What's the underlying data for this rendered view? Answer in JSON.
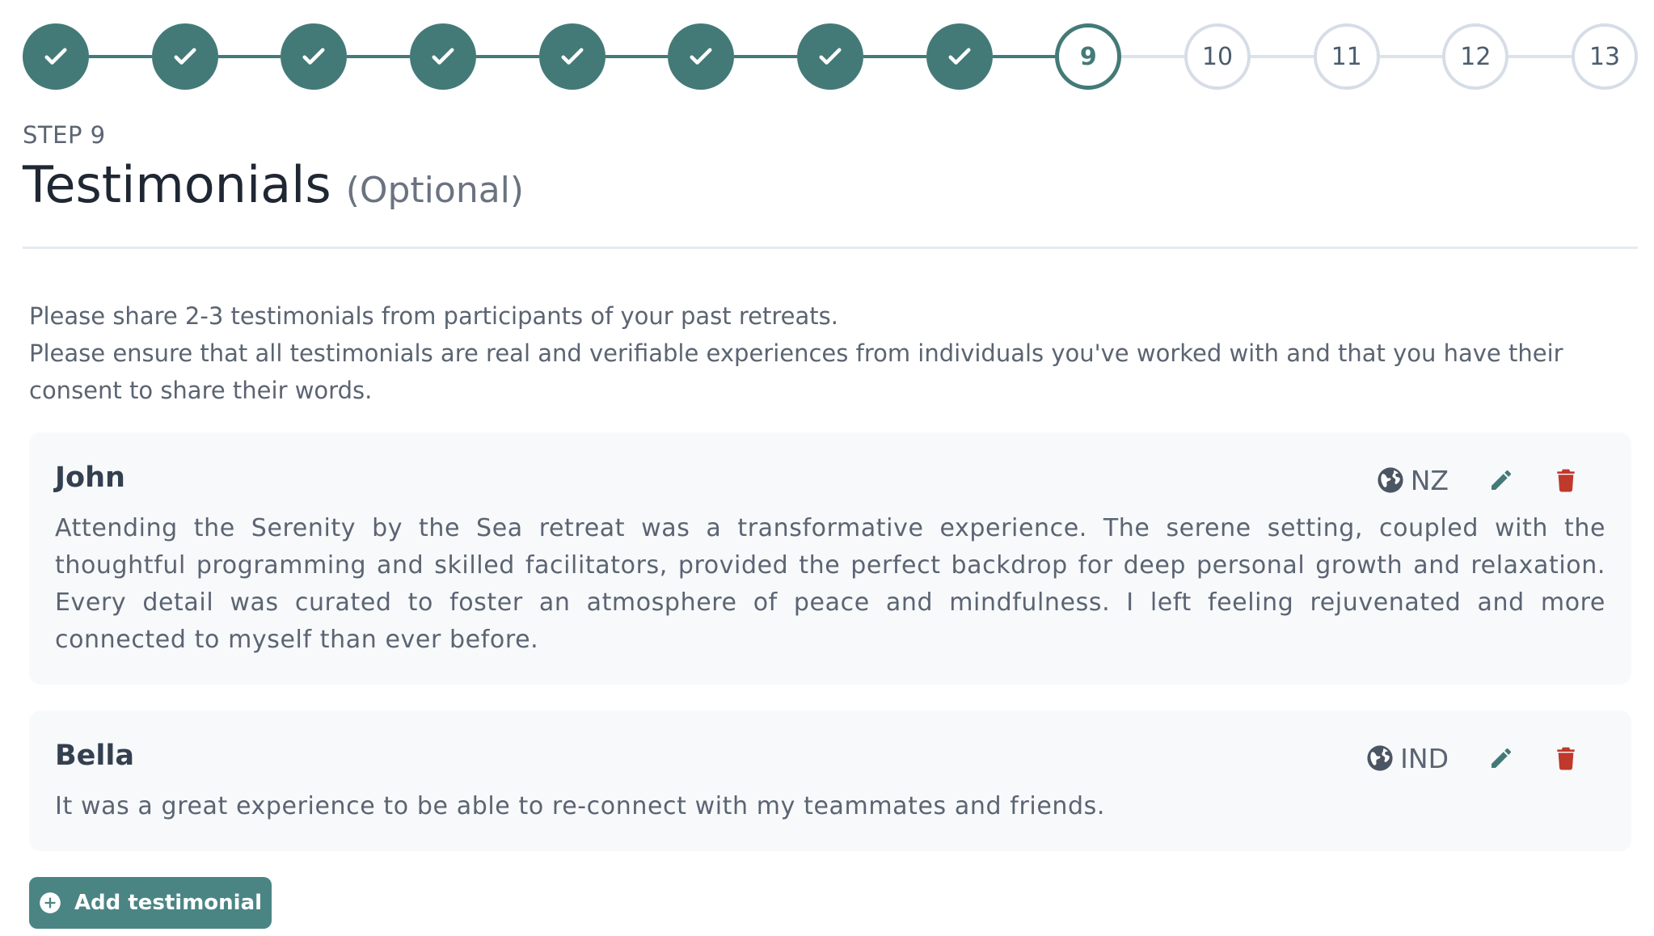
{
  "stepper": {
    "steps": [
      {
        "label": "1",
        "state": "done"
      },
      {
        "label": "2",
        "state": "done"
      },
      {
        "label": "3",
        "state": "done"
      },
      {
        "label": "4",
        "state": "done"
      },
      {
        "label": "5",
        "state": "done"
      },
      {
        "label": "6",
        "state": "done"
      },
      {
        "label": "7",
        "state": "done"
      },
      {
        "label": "8",
        "state": "done"
      },
      {
        "label": "9",
        "state": "current"
      },
      {
        "label": "10",
        "state": "todo"
      },
      {
        "label": "11",
        "state": "todo"
      },
      {
        "label": "12",
        "state": "todo"
      },
      {
        "label": "13",
        "state": "todo"
      }
    ],
    "colors": {
      "done": "#437a77",
      "todo_border": "#d6dde6"
    }
  },
  "header": {
    "kicker": "STEP 9",
    "title": "Testimonials",
    "optional_label": "(Optional)"
  },
  "intro": {
    "line1": "Please share 2-3 testimonials from participants of your past retreats.",
    "line2": "Please ensure that all testimonials are real and verifiable experiences from individuals you've worked with and that you have their consent to share their words."
  },
  "testimonials": [
    {
      "name": "John",
      "country": "NZ",
      "text": "Attending the Serenity by the Sea retreat was a transformative experience. The serene setting, coupled with the thoughtful programming and skilled facilitators, provided the perfect backdrop for deep personal growth and relaxation. Every detail was curated to foster an atmosphere of peace and mindfulness. I left feeling rejuvenated and more connected to myself than ever before."
    },
    {
      "name": "Bella",
      "country": "IND",
      "text": "It was a great experience to be able to re-connect with my teammates and friends."
    }
  ],
  "icons": {
    "check": "check-icon",
    "globe": "globe-icon",
    "edit": "pencil-icon",
    "delete": "trash-icon",
    "add": "plus-circle-icon"
  },
  "colors": {
    "accent": "#437a77",
    "delete": "#c0392b",
    "button": "#4a8584"
  },
  "add_button": {
    "label": "Add testimonial"
  }
}
